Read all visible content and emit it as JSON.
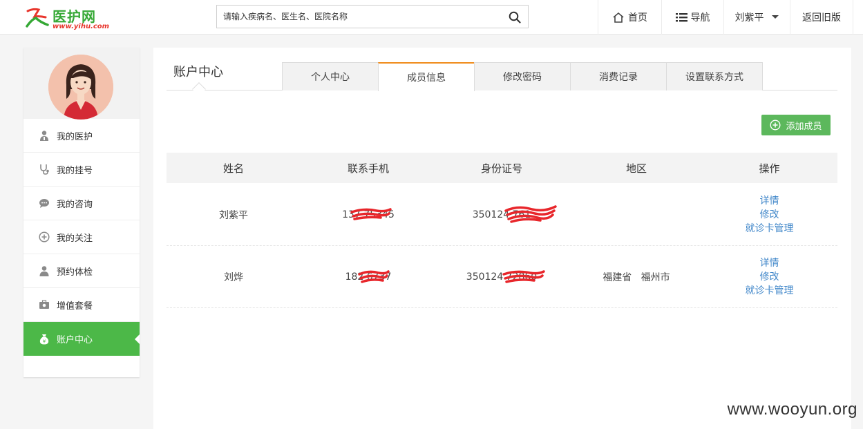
{
  "header": {
    "logo_name": "医护网",
    "logo_url": "www.yihu.com",
    "search_placeholder": "请输入疾病名、医生名、医院名称",
    "nav": {
      "home": "首页",
      "guide": "导航",
      "user": "刘紫平",
      "old_version": "返回旧版"
    }
  },
  "sidebar": {
    "items": [
      {
        "label": "我的医护",
        "icon": "doctor-icon"
      },
      {
        "label": "我的挂号",
        "icon": "stethoscope-icon"
      },
      {
        "label": "我的咨询",
        "icon": "chat-icon"
      },
      {
        "label": "我的关注",
        "icon": "plus-circle-icon"
      },
      {
        "label": "预约体检",
        "icon": "person-icon"
      },
      {
        "label": "增值套餐",
        "icon": "medkit-icon"
      },
      {
        "label": "账户中心",
        "icon": "money-bag-icon",
        "active": true
      }
    ]
  },
  "main": {
    "title": "账户中心",
    "tabs": [
      "个人中心",
      "成员信息",
      "修改密码",
      "消费记录",
      "设置联系方式"
    ],
    "active_tab": "成员信息",
    "add_button": "添加成员",
    "table": {
      "headers": [
        "姓名",
        "联系手机",
        "身份证号",
        "地区",
        "操作"
      ],
      "rows": [
        {
          "name": "刘紫平",
          "phone": "137 75345",
          "id_card": "350124 761",
          "region": "",
          "actions": [
            "详情",
            "修改",
            "就诊卡管理"
          ]
        },
        {
          "name": "刘烨",
          "phone": "182 6737",
          "id_card": "350124 72860",
          "region": "福建省   福州市",
          "actions": [
            "详情",
            "修改",
            "就诊卡管理"
          ]
        }
      ]
    }
  },
  "watermark": "www.wooyun.org",
  "colors": {
    "accent_green": "#4cb848",
    "tab_orange": "#f08c1c",
    "link_blue": "#3f86c9",
    "redaction_red": "#e8262b"
  }
}
